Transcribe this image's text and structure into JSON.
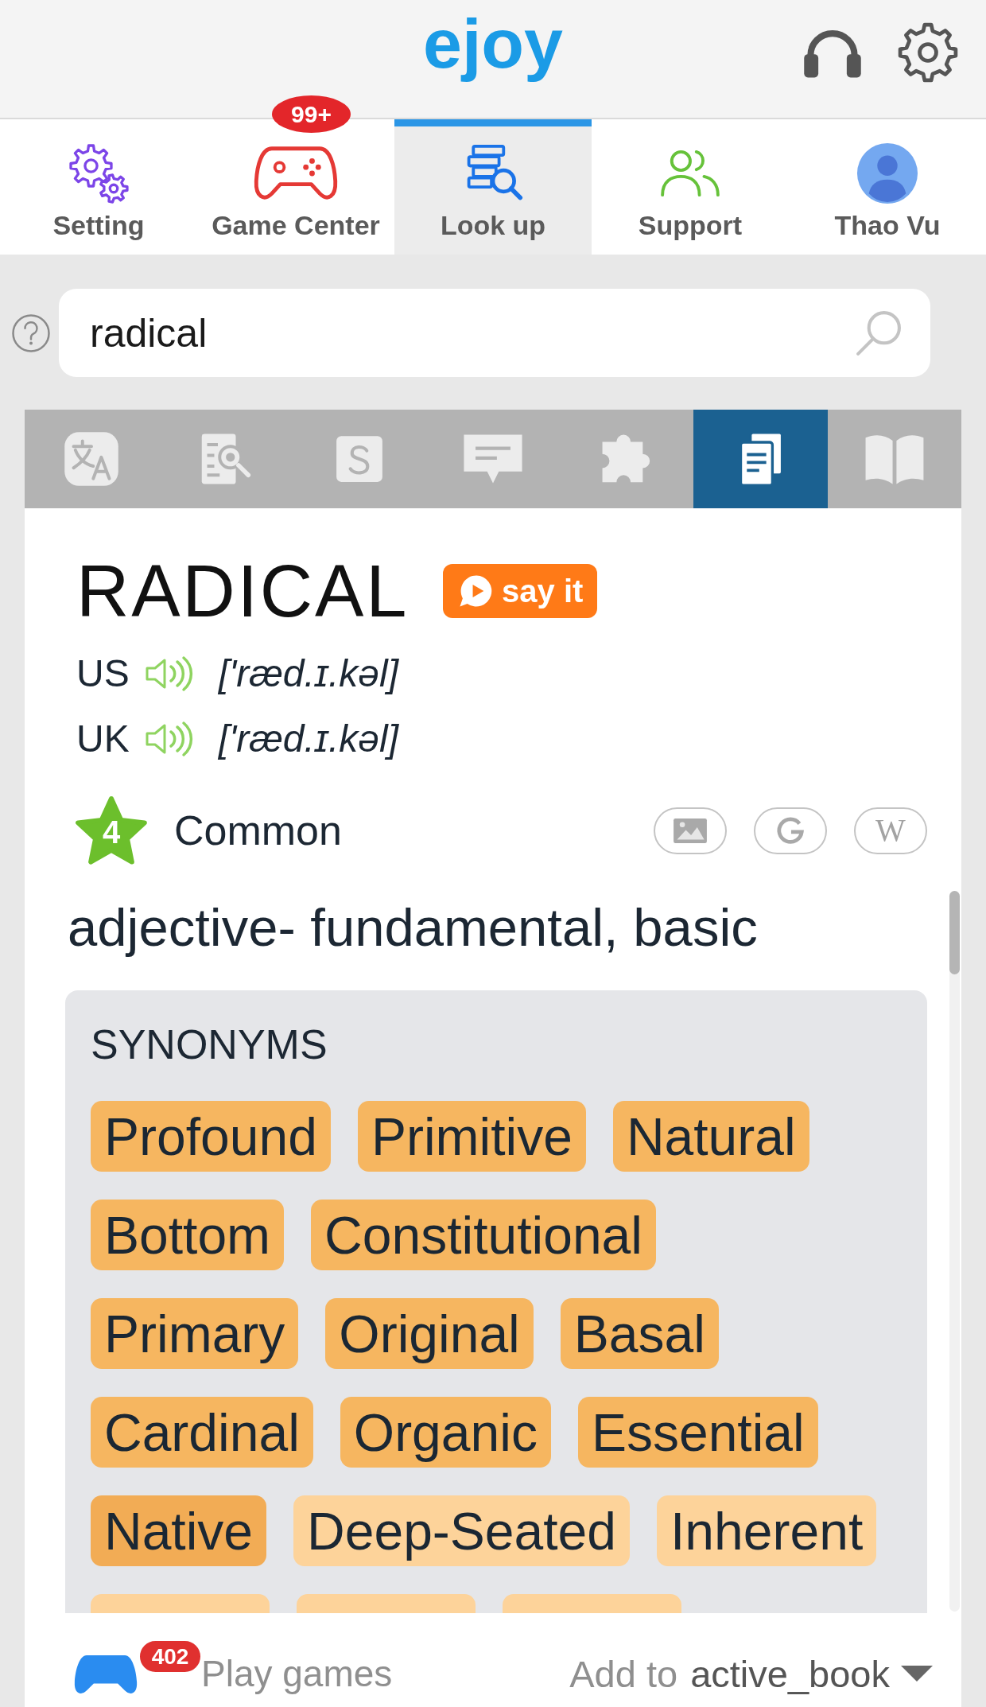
{
  "header": {
    "logo": "ejoy"
  },
  "nav_tabs": [
    {
      "kind": "setting",
      "label": "Setting",
      "selected": false
    },
    {
      "kind": "games",
      "label": "Game Center",
      "badge": "99+",
      "selected": false
    },
    {
      "kind": "lookup",
      "label": "Look up",
      "selected": true
    },
    {
      "kind": "support",
      "label": "Support",
      "selected": false
    },
    {
      "kind": "profile",
      "label": "Thao Vu",
      "selected": false
    }
  ],
  "search": {
    "value": "radical"
  },
  "tool_tabs": [
    {
      "kind": "translate",
      "selected": false
    },
    {
      "kind": "explain",
      "selected": false
    },
    {
      "kind": "letter",
      "selected": false
    },
    {
      "kind": "comment",
      "selected": false
    },
    {
      "kind": "puzzle",
      "selected": false
    },
    {
      "kind": "documents",
      "selected": true
    },
    {
      "kind": "book",
      "selected": false
    }
  ],
  "entry": {
    "word": "RADICAL",
    "say_it": "say it",
    "pronunciations": [
      {
        "region": "US",
        "ipa": "['ræd.ɪ.kəl]"
      },
      {
        "region": "UK",
        "ipa": "['ræd.ɪ.kəl]"
      }
    ],
    "frequency": {
      "rank": "4",
      "label": "Common"
    },
    "links": [
      {
        "kind": "image"
      },
      {
        "kind": "google"
      },
      {
        "kind": "wiki",
        "text": "W"
      }
    ],
    "definition": "adjective- fundamental, basic"
  },
  "synonyms": {
    "title": "SYNONYMS",
    "rows": [
      [
        {
          "label": "Profound",
          "color": "#f6b660"
        },
        {
          "label": "Primitive",
          "color": "#f6b660"
        },
        {
          "label": "Natural",
          "color": "#f6b660"
        }
      ],
      [
        {
          "label": "Bottom",
          "color": "#f6b660"
        },
        {
          "label": "Constitutional",
          "color": "#f6b660"
        }
      ],
      [
        {
          "label": "Primary",
          "color": "#f6b660"
        },
        {
          "label": "Original",
          "color": "#f6b660"
        },
        {
          "label": "Basal",
          "color": "#f6b660"
        }
      ],
      [
        {
          "label": "Cardinal",
          "color": "#f6b660"
        },
        {
          "label": "Organic",
          "color": "#f6b660"
        },
        {
          "label": "Essential",
          "color": "#f6b660"
        }
      ],
      [
        {
          "label": "Native",
          "color": "#f2ac55"
        },
        {
          "label": "Deep-Seated",
          "color": "#fdd39a"
        },
        {
          "label": "Inherent",
          "color": "#fdd39a"
        }
      ],
      [
        {
          "color": "#fdd39a"
        },
        {
          "color": "#fdd39a"
        },
        {
          "color": "#fdd39a"
        }
      ]
    ]
  },
  "footer": {
    "play_games": "Play games",
    "games_badge": "402",
    "add_to": "Add to",
    "book": "active_book"
  }
}
